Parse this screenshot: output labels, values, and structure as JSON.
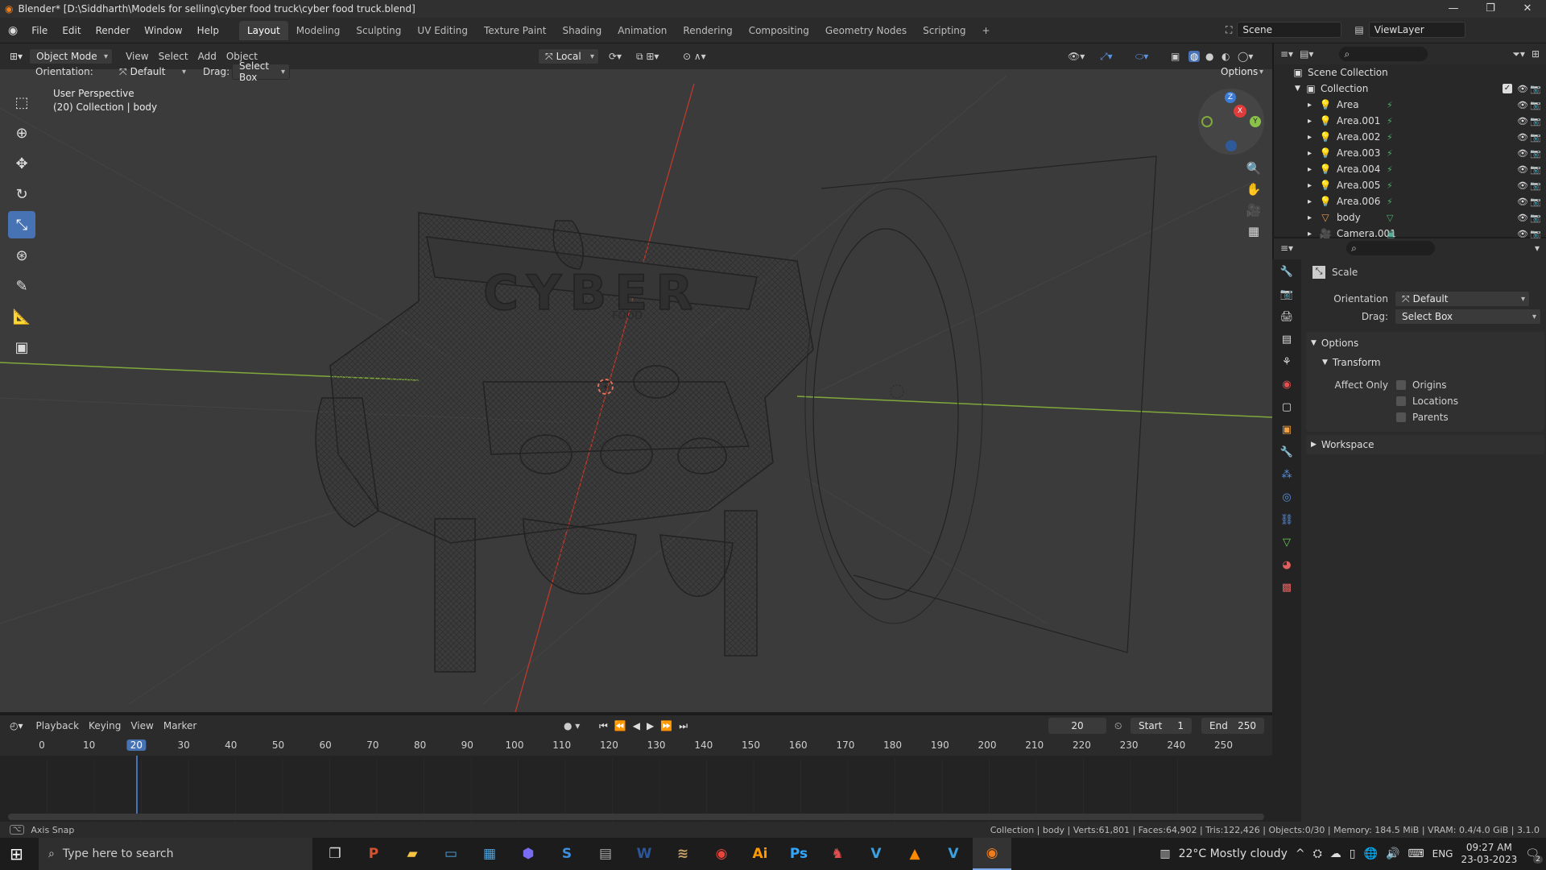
{
  "titlebar": {
    "title": "Blender* [D:\\Siddharth\\Models for selling\\cyber food truck\\cyber food truck.blend]",
    "min": "—",
    "max": "❐",
    "close": "✕"
  },
  "menu": {
    "items": [
      "File",
      "Edit",
      "Render",
      "Window",
      "Help"
    ]
  },
  "workspaces": [
    "Layout",
    "Modeling",
    "Sculpting",
    "UV Editing",
    "Texture Paint",
    "Shading",
    "Animation",
    "Rendering",
    "Compositing",
    "Geometry Nodes",
    "Scripting",
    "+"
  ],
  "scene": {
    "name": "Scene",
    "viewlayer": "ViewLayer"
  },
  "viewport_header": {
    "mode": "Object Mode",
    "menus": [
      "View",
      "Select",
      "Add",
      "Object"
    ],
    "transform_orientation": "Local"
  },
  "tool_options": {
    "orientation_label": "Orientation:",
    "orientation_value": "Default",
    "drag_label": "Drag:",
    "drag_value": "Select Box",
    "options": "Options"
  },
  "viewport": {
    "line1": "User Perspective",
    "line2": "(20) Collection | body",
    "truck_sign": "CYBER",
    "truck_sign_sub": "FOOD"
  },
  "gizmo": {
    "z": "Z",
    "x": "X",
    "y": "Y"
  },
  "outliner": {
    "root": "Scene Collection",
    "collection": "Collection",
    "items": [
      "Area",
      "Area.001",
      "Area.002",
      "Area.003",
      "Area.004",
      "Area.005",
      "Area.006",
      "body",
      "Camera.001"
    ]
  },
  "properties": {
    "tool_name": "Scale",
    "orientation_label": "Orientation",
    "orientation_value": "Default",
    "drag_label": "Drag:",
    "drag_value": "Select Box",
    "options_label": "Options",
    "transform_label": "Transform",
    "affect_only": "Affect Only",
    "chk_origins": "Origins",
    "chk_locations": "Locations",
    "chk_parents": "Parents",
    "workspace_label": "Workspace"
  },
  "timeline": {
    "menus": [
      "Playback",
      "Keying",
      "View",
      "Marker"
    ],
    "current_frame": "20",
    "start_label": "Start",
    "start_value": "1",
    "end_label": "End",
    "end_value": "250",
    "ticks": [
      "0",
      "10",
      "20",
      "30",
      "40",
      "50",
      "60",
      "70",
      "80",
      "90",
      "100",
      "110",
      "120",
      "130",
      "140",
      "150",
      "160",
      "170",
      "180",
      "190",
      "200",
      "210",
      "220",
      "230",
      "240",
      "250"
    ]
  },
  "status": {
    "left": "Axis Snap",
    "right": "Collection | body | Verts:61,801 | Faces:64,902 | Tris:122,426 | Objects:0/30 | Memory: 184.5 MiB | VRAM: 0.4/4.0 GiB | 3.1.0"
  },
  "taskbar": {
    "search_placeholder": "Type here to search",
    "weather": "22°C  Mostly cloudy",
    "lang": "ENG",
    "time": "09:27 AM",
    "date": "23-03-2023",
    "notif": "2"
  },
  "colors": {
    "accent": "#4772b3",
    "x_axis": "#e03c3c",
    "y_axis": "#8bc34a",
    "z_axis": "#3d7cd6"
  }
}
